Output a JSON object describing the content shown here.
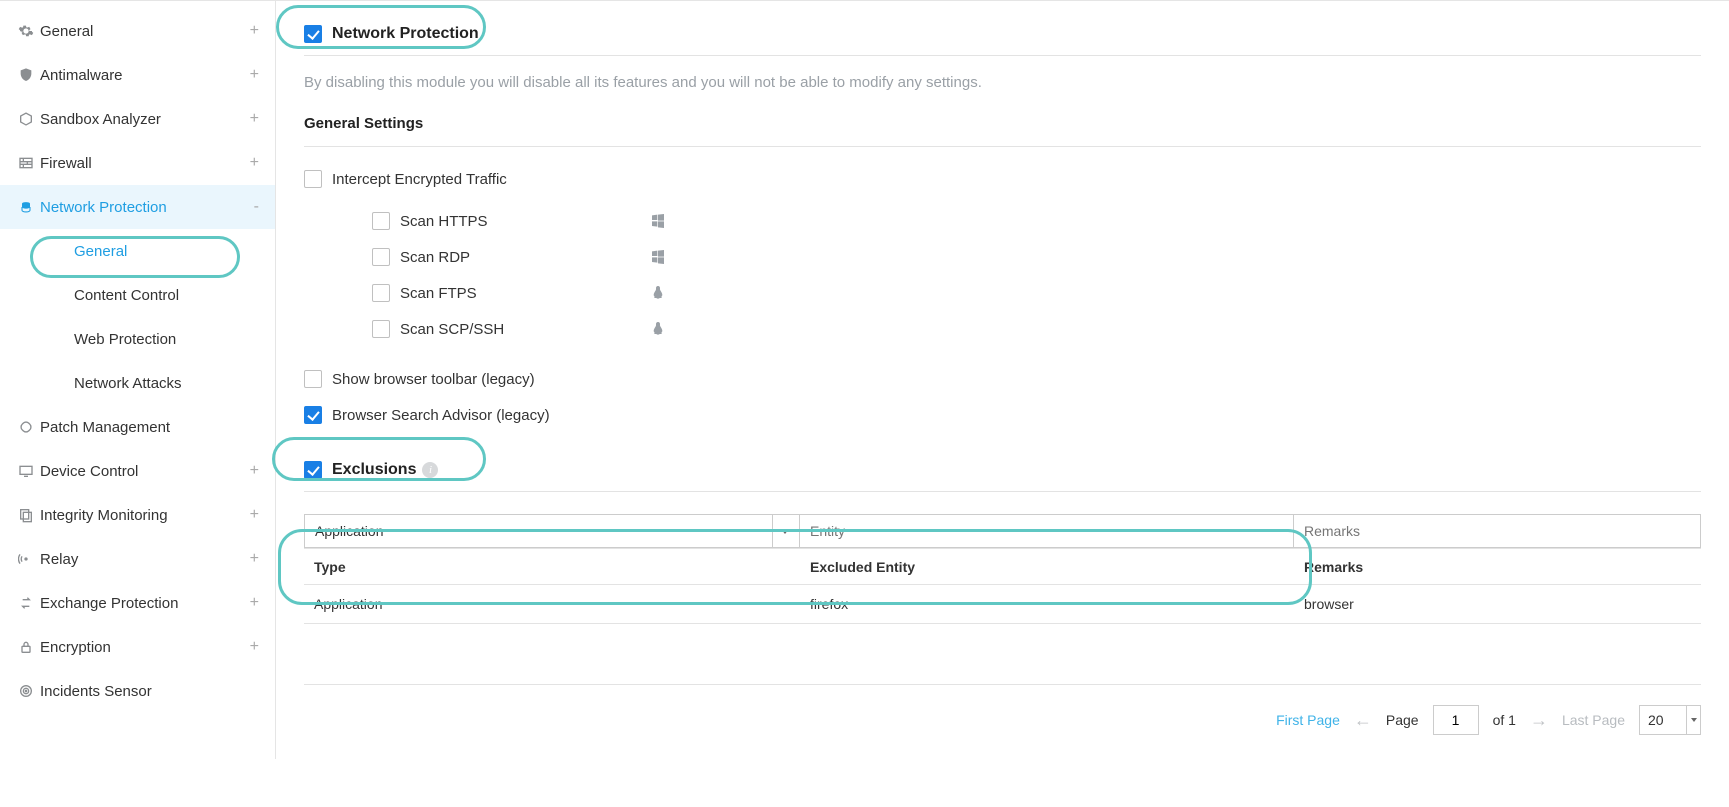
{
  "sidebar": {
    "items": [
      {
        "label": "General",
        "expand": "+"
      },
      {
        "label": "Antimalware",
        "expand": "+"
      },
      {
        "label": "Sandbox Analyzer",
        "expand": "+"
      },
      {
        "label": "Firewall",
        "expand": "+"
      },
      {
        "label": "Network Protection",
        "expand": "-"
      },
      {
        "label": "Patch Management",
        "expand": ""
      },
      {
        "label": "Device Control",
        "expand": "+"
      },
      {
        "label": "Integrity Monitoring",
        "expand": "+"
      },
      {
        "label": "Relay",
        "expand": "+"
      },
      {
        "label": "Exchange Protection",
        "expand": "+"
      },
      {
        "label": "Encryption",
        "expand": "+"
      },
      {
        "label": "Incidents Sensor",
        "expand": ""
      }
    ],
    "sub": [
      {
        "label": "General"
      },
      {
        "label": "Content Control"
      },
      {
        "label": "Web Protection"
      },
      {
        "label": "Network Attacks"
      }
    ]
  },
  "section1": {
    "title": "Network Protection",
    "hint": "By disabling this module you will disable all its features and you will not be able to modify any settings.",
    "gs_title": "General Settings",
    "opts": {
      "intercept": "Intercept Encrypted Traffic",
      "https": "Scan HTTPS",
      "rdp": "Scan RDP",
      "ftps": "Scan FTPS",
      "scp": "Scan SCP/SSH",
      "toolbar": "Show browser toolbar (legacy)",
      "advisor": "Browser Search Advisor (legacy)"
    }
  },
  "section2": {
    "title": "Exclusions",
    "filter": {
      "type": "Application",
      "entity_ph": "Entity",
      "remarks_ph": "Remarks"
    },
    "headers": {
      "c1": "Type",
      "c2": "Excluded Entity",
      "c3": "Remarks"
    },
    "rows": [
      {
        "c1": "Application",
        "c2": "firefox",
        "c3": "browser"
      }
    ]
  },
  "pager": {
    "first": "First Page",
    "page_label": "Page",
    "page_val": "1",
    "of": "of 1",
    "last": "Last Page",
    "size": "20"
  }
}
